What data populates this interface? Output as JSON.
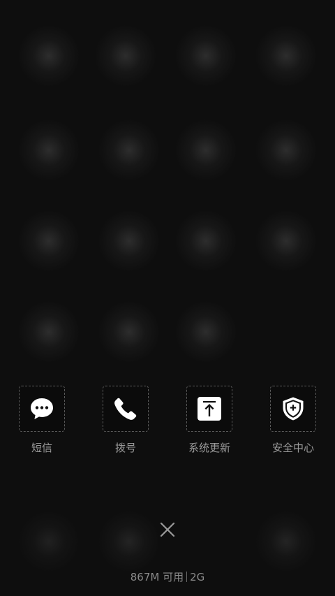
{
  "recent_apps": [
    {
      "label": "短信",
      "icon": "message-bubble-icon"
    },
    {
      "label": "拨号",
      "icon": "phone-icon"
    },
    {
      "label": "系统更新",
      "icon": "upload-arrow-icon"
    },
    {
      "label": "安全中心",
      "icon": "shield-plus-icon"
    }
  ],
  "close_icon": "close-icon",
  "memory": {
    "available": "867M 可用",
    "total": "2G"
  },
  "colors": {
    "background": "#0e0e0e",
    "label": "#9a9a9a",
    "icon": "#ffffff"
  }
}
